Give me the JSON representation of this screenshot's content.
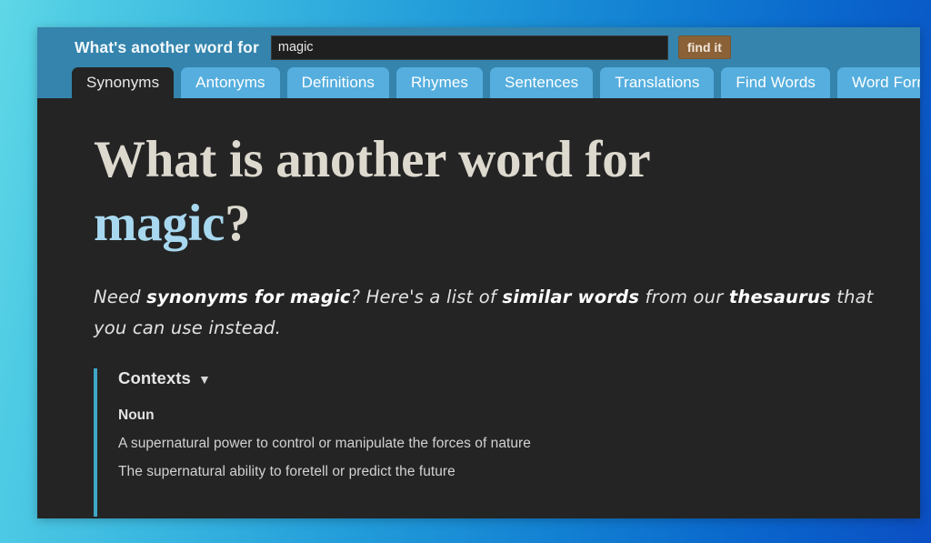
{
  "header": {
    "prompt_label": "What's another word for",
    "search": {
      "value": "magic",
      "placeholder": ""
    },
    "find_button_label": "find it"
  },
  "tabs": [
    {
      "label": "Synonyms",
      "active": true
    },
    {
      "label": "Antonyms",
      "active": false
    },
    {
      "label": "Definitions",
      "active": false
    },
    {
      "label": "Rhymes",
      "active": false
    },
    {
      "label": "Sentences",
      "active": false
    },
    {
      "label": "Translations",
      "active": false
    },
    {
      "label": "Find Words",
      "active": false
    },
    {
      "label": "Word Forms",
      "active": false
    }
  ],
  "main": {
    "headline_prefix": "What is another word for",
    "headline_query": "magic",
    "headline_suffix": "?",
    "lede": {
      "part1": "Need ",
      "strong1": "synonyms for magic",
      "part2": "? Here's a list of ",
      "strong2": "similar words",
      "part3": " from our ",
      "strong3": "thesaurus",
      "part4": " that you can use instead."
    },
    "contexts": {
      "title": "Contexts",
      "caret": "▼",
      "part_of_speech": "Noun",
      "senses": [
        "A supernatural power to control or manipulate the forces of nature",
        "The supernatural ability to foretell or predict the future"
      ]
    }
  },
  "colors": {
    "page_gradient_start": "#5fd7e6",
    "page_gradient_end": "#0b4fc4",
    "header_bar": "#3484ad",
    "tab_inactive": "#55aede",
    "tab_active": "#242424",
    "content_bg": "#242424",
    "find_button": "#8b6137",
    "accent_bar": "#3fa6c6",
    "headline_query": "#a7d8ef",
    "headline_text": "#ddd9cf"
  }
}
